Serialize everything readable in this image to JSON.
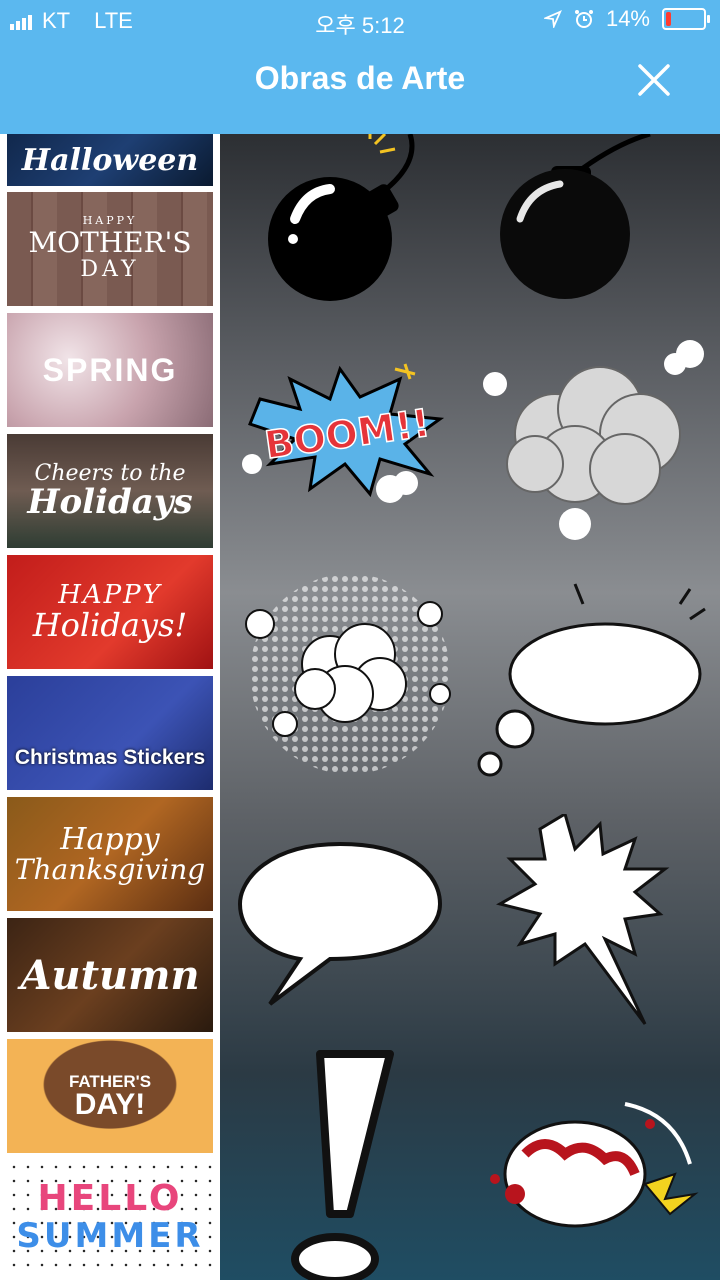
{
  "status_bar": {
    "carrier": "KT",
    "network": "LTE",
    "time": "오후 5:12",
    "battery": "14%",
    "battery_level": 0.14,
    "battery_color": "#ff3b30"
  },
  "header": {
    "title": "Obras de Arte",
    "background": "#5bb8ef"
  },
  "sidebar": {
    "collections": [
      {
        "label": "Halloween"
      },
      {
        "label_small": "HAPPY",
        "label": "MOTHER'S",
        "label_sub": "DAY"
      },
      {
        "label": "SPRING"
      },
      {
        "label": "Cheers to the",
        "label_sub": "Holidays"
      },
      {
        "label": "HAPPY",
        "label_sub": "Holidays!"
      },
      {
        "label": "Christmas Stickers"
      },
      {
        "label": "Happy",
        "label_sub": "Thanksgiving"
      },
      {
        "label": "Autumn"
      },
      {
        "label": "FATHER'S",
        "label_sub": "DAY!"
      },
      {
        "label": "HELLO",
        "label_sub": "SUMMER"
      }
    ]
  },
  "stickers": [
    {
      "icon": "bomb-icon"
    },
    {
      "icon": "bomb-icon"
    },
    {
      "icon": "boom-burst-icon",
      "text": "BOOM!!"
    },
    {
      "icon": "smoke-cloud-icon"
    },
    {
      "icon": "halftone-explosion-icon"
    },
    {
      "icon": "thought-cloud-icon"
    },
    {
      "icon": "speech-bubble-icon"
    },
    {
      "icon": "spiky-bubble-icon"
    },
    {
      "icon": "exclamation-icon"
    },
    {
      "icon": "punch-fist-icon"
    }
  ]
}
